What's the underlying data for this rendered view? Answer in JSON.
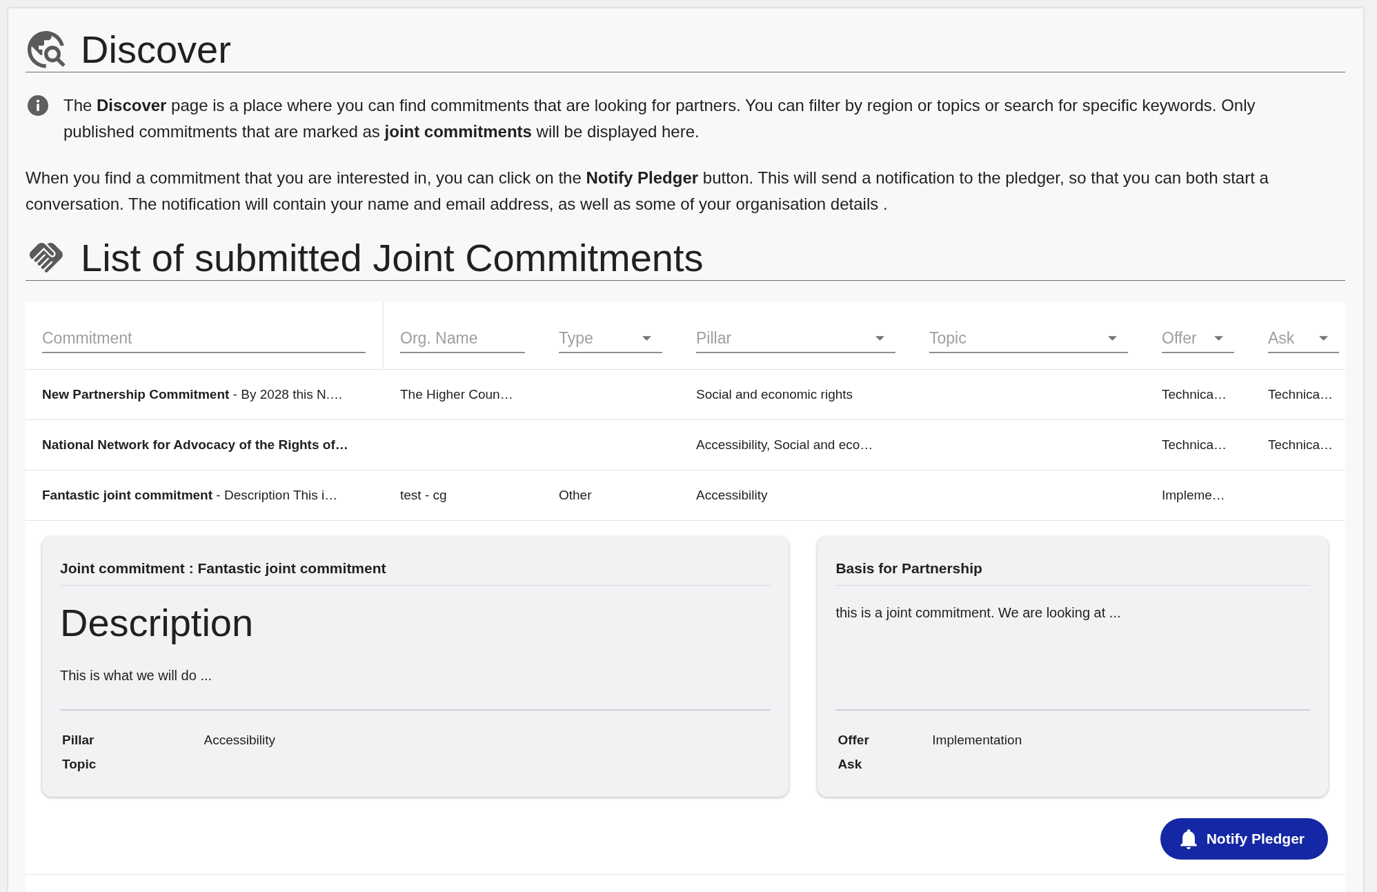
{
  "header": {
    "title": "Discover"
  },
  "intro": [
    {
      "kind": "info",
      "text": "The **Discover** page is a place where you can find commitments that are looking for partners. You can filter by region or topics or search for specific keywords. Only published commitments that are marked as **joint commitments** will be displayed here."
    },
    {
      "kind": "plain",
      "text": "When you find a commitment that you are interested in, you can click on the **Notify Pledger** button. This will send a notification to the pledger, so that you can both start a conversation. The notification will contain your name and email address, as well as some of your organisation details ."
    }
  ],
  "list_section": {
    "title": "List of submitted Joint Commitments",
    "table": {
      "columns": [
        {
          "placeholder": "Commitment",
          "kind": "text"
        },
        {
          "placeholder": "Org. Name",
          "kind": "text"
        },
        {
          "placeholder": "Type",
          "kind": "select"
        },
        {
          "placeholder": "Pillar",
          "kind": "select"
        },
        {
          "placeholder": "Topic",
          "kind": "select"
        },
        {
          "placeholder": "Offer",
          "kind": "select"
        },
        {
          "placeholder": "Ask",
          "kind": "select"
        }
      ],
      "rows": [
        {
          "commitment": {
            "title": "New Partnership Commitment",
            "summary": "- By 2028 this N.…"
          },
          "org_name": "The Higher Coun…",
          "pillar": "Social and economic rights",
          "offer": "Technica…",
          "ask": "Technica…"
        },
        {
          "commitment": {
            "title": "National Network for Advocacy of the Rights of…"
          },
          "pillar": "Accessibility, Social and eco…",
          "offer": "Technica…",
          "ask": "Technica…"
        },
        {
          "commitment": {
            "title": "Fantastic joint commitment",
            "summary": "- Description This i…"
          },
          "org_name": "test - cg",
          "type": "Other",
          "pillar": "Accessibility",
          "offer": "Impleme…",
          "detail": {
            "cards": [
              {
                "title": "Joint commitment : Fantastic joint commitment",
                "heading": "Description",
                "text": "This is what we will do ...",
                "fields": [
                  {
                    "label": "Pillar",
                    "value": "Accessibility"
                  },
                  {
                    "label": "Topic"
                  }
                ]
              },
              {
                "title": "Basis for Partnership",
                "text": "this is a joint commitment. We are looking at ...",
                "fields": [
                  {
                    "label": "Offer",
                    "value": "Implementation"
                  },
                  {
                    "label": "Ask"
                  }
                ]
              }
            ],
            "button": {
              "label": "Notify Pledger"
            }
          }
        }
      ]
    }
  }
}
